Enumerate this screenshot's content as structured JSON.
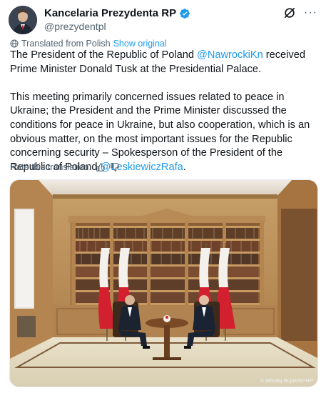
{
  "account": {
    "display_name": "Kancelaria Prezydenta RP",
    "handle": "@prezydentpl",
    "verified_icon": "verified-badge-icon"
  },
  "actions": {
    "grok_icon": "grok-icon",
    "more_icon": "more-icon"
  },
  "translation": {
    "notice": "Translated from Polish",
    "show_original": "Show original"
  },
  "tweet": {
    "p1_before": "The President of the Republic of Poland ",
    "p1_mention": "@NawrockiKn",
    "p1_after": " received Prime Minister Donald Tusk at the Presidential Palace.",
    "p2_before": "This meeting primarily concerned issues related to peace in Ukraine; the President and the Prime Minister discussed the conditions for peace in Ukraine, but also cooperation, which is an obvious matter, on the most important issues for the Republic concerning security – Spokesperson of the President of the Republic of Poland ",
    "p2_mention": "@LeskiewiczRafa",
    "p2_after": "."
  },
  "rating": {
    "label": "Rate this translation:",
    "thumbs_up_icon": "thumbs-up-icon",
    "thumbs_down_icon": "thumbs-down-icon"
  },
  "photo": {
    "credit": "© Mikołaj Bujak/KPRP",
    "flag_colors": {
      "white": "#f4f1ec",
      "red": "#d2202f"
    },
    "wood_color": "#b98a54"
  }
}
